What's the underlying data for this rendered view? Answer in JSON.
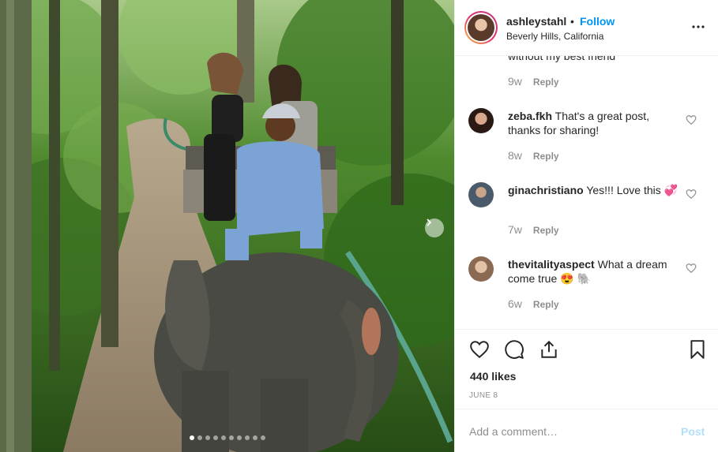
{
  "post": {
    "image_alt": "",
    "dots": {
      "count": 10,
      "active_index": 0
    },
    "next_icon": "chevron-right-icon"
  },
  "header": {
    "username": "ashleystahl",
    "separator": "•",
    "follow_label": "Follow",
    "location": "Beverly Hills, California",
    "more_icon": "more-options-icon"
  },
  "comments": {
    "cut_text": "without my best friend",
    "first_meta": {
      "age": "9w",
      "reply_label": "Reply"
    },
    "items": [
      {
        "user": "zeba.fkh",
        "text": "That's a great post, thanks for sharing!",
        "age": "8w",
        "reply_label": "Reply"
      },
      {
        "user": "ginachristiano",
        "text": "Yes!!! Love this 💞",
        "age": "7w",
        "reply_label": "Reply"
      },
      {
        "user": "thevitalityaspect",
        "text": "What a dream come true 😍 🐘",
        "age": "6w",
        "reply_label": "Reply"
      }
    ]
  },
  "actions": {
    "like_icon": "heart-icon",
    "comment_icon": "comment-icon",
    "share_icon": "share-icon",
    "save_icon": "bookmark-icon",
    "likes": "440 likes",
    "date": "JUNE 8"
  },
  "add_comment": {
    "placeholder": "Add a comment…",
    "post_label": "Post"
  },
  "colors": {
    "accent": "#0095f6",
    "post_disabled": "#b2dffc",
    "muted": "#8e8e8e",
    "text": "#262626",
    "border": "#efefef"
  }
}
